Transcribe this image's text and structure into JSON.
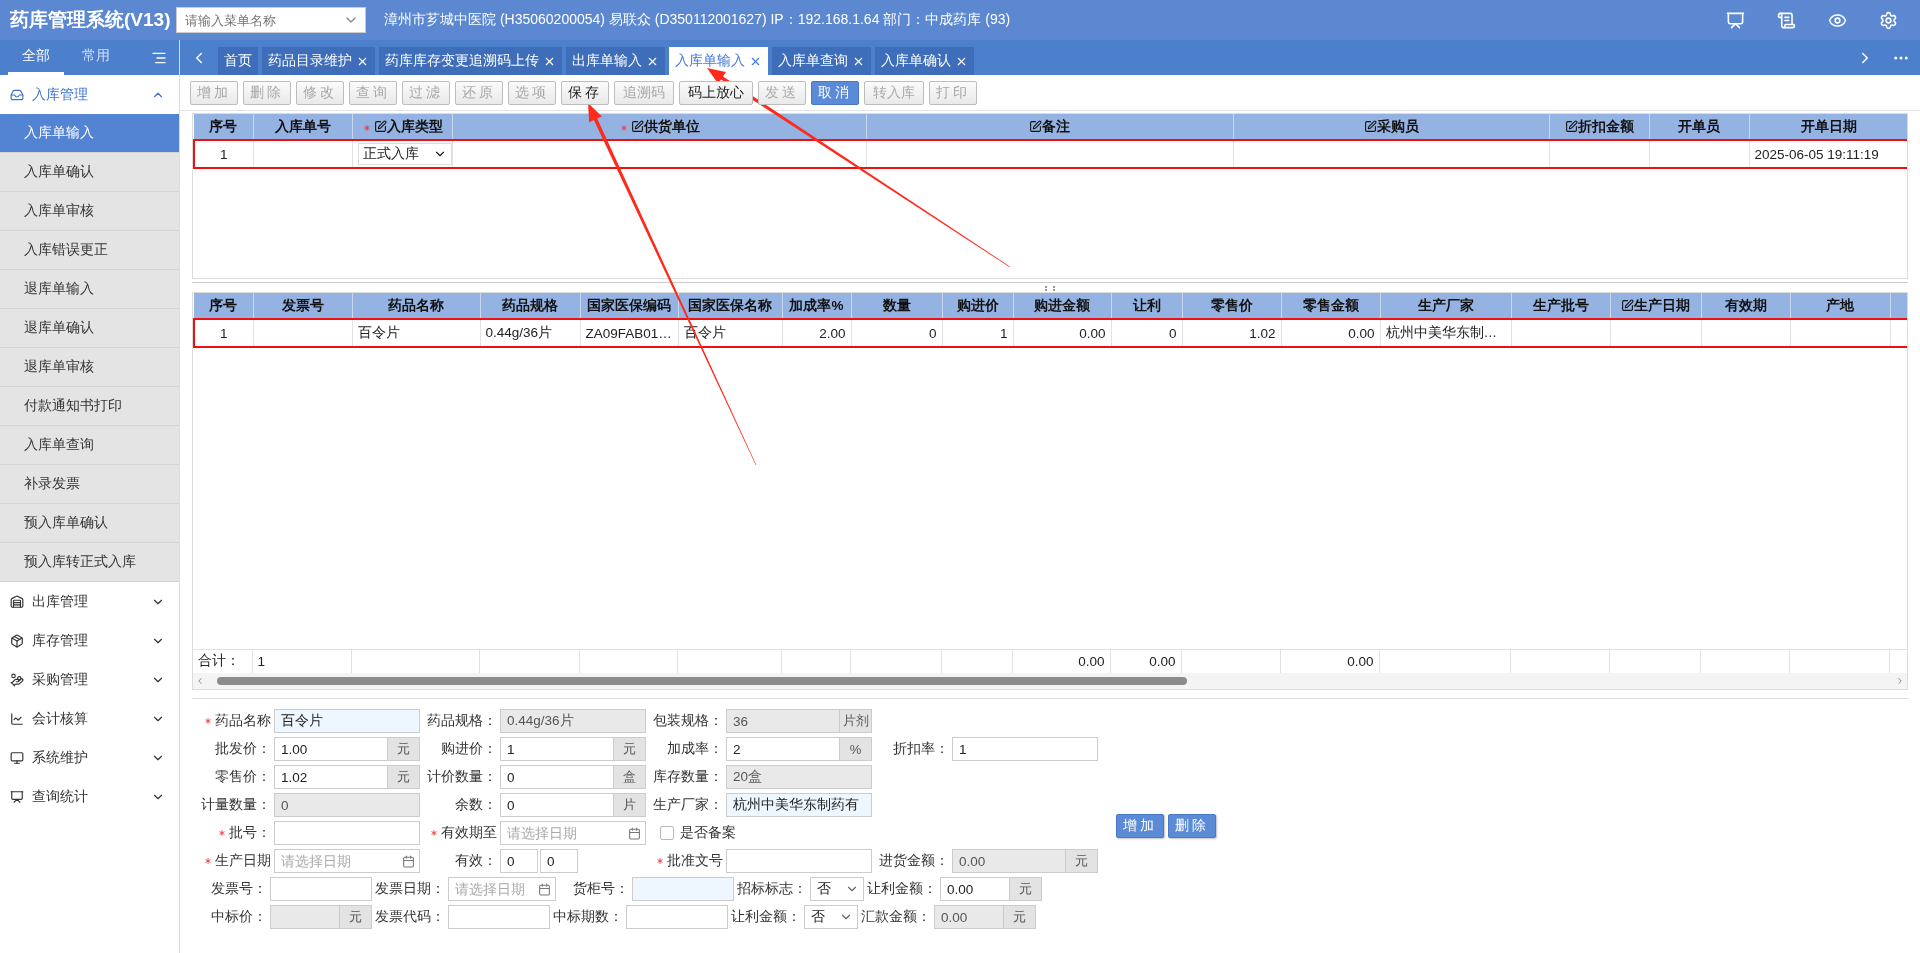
{
  "header": {
    "title": "药库管理系统(V13)",
    "menu_search": {
      "placeholder": "请输入菜单名称"
    },
    "info": "漳州市芗城中医院 (H35060200054) 易联众 (D350112001627) IP：192.168.1.64 部门：中成药库 (93)"
  },
  "sidebar": {
    "tabs": [
      {
        "label": "全部",
        "selected": true
      },
      {
        "label": "常用",
        "selected": false
      }
    ],
    "groups": [
      {
        "label": "入库管理",
        "expanded": true,
        "children": [
          {
            "label": "入库单输入",
            "selected": true
          },
          {
            "label": "入库单确认",
            "selected": false
          },
          {
            "label": "入库单审核",
            "selected": false
          },
          {
            "label": "入库错误更正",
            "selected": false
          },
          {
            "label": "退库单输入",
            "selected": false
          },
          {
            "label": "退库单确认",
            "selected": false
          },
          {
            "label": "退库单审核",
            "selected": false
          },
          {
            "label": "付款通知书打印",
            "selected": false
          },
          {
            "label": "入库单查询",
            "selected": false
          },
          {
            "label": "补录发票",
            "selected": false
          },
          {
            "label": "预入库单确认",
            "selected": false
          },
          {
            "label": "预入库转正式入库",
            "selected": false
          }
        ]
      },
      {
        "label": "出库管理",
        "expanded": false
      },
      {
        "label": "库存管理",
        "expanded": false
      },
      {
        "label": "采购管理",
        "expanded": false
      },
      {
        "label": "会计核算",
        "expanded": false
      },
      {
        "label": "系统维护",
        "expanded": false
      },
      {
        "label": "查询统计",
        "expanded": false
      }
    ]
  },
  "tabs": [
    {
      "label": "首页",
      "closable": false,
      "selected": false
    },
    {
      "label": "药品目录维护",
      "closable": true,
      "selected": false
    },
    {
      "label": "药库库存变更追溯码上传",
      "closable": true,
      "selected": false
    },
    {
      "label": "出库单输入",
      "closable": true,
      "selected": false
    },
    {
      "label": "入库单输入",
      "closable": true,
      "selected": true
    },
    {
      "label": "入库单查询",
      "closable": true,
      "selected": false
    },
    {
      "label": "入库单确认",
      "closable": true,
      "selected": false
    }
  ],
  "toolbar": [
    {
      "label": "增加",
      "disabled": true,
      "primary": false
    },
    {
      "label": "删除",
      "disabled": true,
      "primary": false
    },
    {
      "label": "修改",
      "disabled": true,
      "primary": false
    },
    {
      "label": "查询",
      "disabled": true,
      "primary": false
    },
    {
      "label": "过滤",
      "disabled": true,
      "primary": false
    },
    {
      "label": "还原",
      "disabled": true,
      "primary": false
    },
    {
      "label": "选项",
      "disabled": true,
      "primary": false
    },
    {
      "label": "保存",
      "disabled": false,
      "primary": false
    },
    {
      "label": "追溯码",
      "disabled": true,
      "primary": false
    },
    {
      "label": "码上放心",
      "disabled": false,
      "primary": false
    },
    {
      "label": "发送",
      "disabled": true,
      "primary": false
    },
    {
      "label": "取消",
      "disabled": false,
      "primary": true
    },
    {
      "label": "转入库",
      "disabled": true,
      "primary": false
    },
    {
      "label": "打印",
      "disabled": true,
      "primary": false
    }
  ],
  "upper_table": {
    "columns": [
      {
        "label": "序号"
      },
      {
        "label": "入库单号"
      },
      {
        "label": "入库类型",
        "required": true,
        "editable": true,
        "kind": "select"
      },
      {
        "label": "供货单位",
        "required": true,
        "editable": true
      },
      {
        "label": "备注",
        "editable": true
      },
      {
        "label": "采购员",
        "editable": true
      },
      {
        "label": "折扣金额",
        "editable": true
      },
      {
        "label": "开单员"
      },
      {
        "label": "开单日期"
      }
    ],
    "rows": [
      {
        "outlined": true,
        "cells": [
          "1",
          null,
          "正式入库",
          null,
          null,
          null,
          null,
          null,
          "2025-06-05 19:11:19"
        ]
      }
    ]
  },
  "lower_table": {
    "columns": [
      {
        "label": "序号"
      },
      {
        "label": "发票号",
        "total": "1"
      },
      {
        "label": "药品名称"
      },
      {
        "label": "药品规格"
      },
      {
        "label": "国家医保编码"
      },
      {
        "label": "国家医保名称"
      },
      {
        "label": "加成率%"
      },
      {
        "label": "数量"
      },
      {
        "label": "购进价"
      },
      {
        "label": "购进金额",
        "total": "0.00"
      },
      {
        "label": "让利",
        "total": "0.00"
      },
      {
        "label": "零售价"
      },
      {
        "label": "零售金额",
        "total": "0.00"
      },
      {
        "label": "生产厂家"
      },
      {
        "label": "生产批号"
      },
      {
        "label": "生产日期",
        "editable": true
      },
      {
        "label": "有效期"
      },
      {
        "label": "产地"
      }
    ],
    "rows": [
      {
        "outlined": true,
        "cells": [
          "1",
          null,
          "百令片",
          "0.44g/36片",
          "ZA09FAB01…",
          "百令片",
          "2.00",
          "0",
          "1",
          "0.00",
          "0",
          "1.02",
          "0.00",
          "杭州中美华东制…",
          null,
          null,
          null,
          null
        ]
      }
    ],
    "totals_label": "合计："
  },
  "form": {
    "rows": [
      [
        {
          "kind": "text",
          "label": "药品名称",
          "required": true,
          "value": "百令片",
          "highlighted": true
        },
        {
          "kind": "text",
          "label": "药品规格：",
          "value": "0.44g/36片",
          "readonly": true
        },
        {
          "kind": "text",
          "label": "包装规格：",
          "value": "36",
          "readonly": true,
          "unit": "片剂"
        }
      ],
      [
        {
          "kind": "text",
          "label": "批发价：",
          "value": "1.00",
          "unit": "元"
        },
        {
          "kind": "text",
          "label": "购进价：",
          "value": "1",
          "unit": "元"
        },
        {
          "kind": "text",
          "label": "加成率：",
          "value": "2",
          "unit": "%"
        },
        {
          "kind": "text",
          "label": "折扣率：",
          "value": "1"
        }
      ],
      [
        {
          "kind": "text",
          "label": "零售价：",
          "value": "1.02",
          "unit": "元"
        },
        {
          "kind": "text",
          "label": "计价数量：",
          "value": "0",
          "unit": "盒"
        },
        {
          "kind": "text",
          "label": "库存数量：",
          "value": "20盒",
          "readonly": true
        }
      ],
      [
        {
          "kind": "text",
          "label": "计量数量：",
          "value": "0",
          "readonly": true
        },
        {
          "kind": "text",
          "label": "余数：",
          "value": "0",
          "unit": "片"
        },
        {
          "kind": "text",
          "label": "生产厂家：",
          "value": "杭州中美华东制药有",
          "highlighted": true
        }
      ],
      [
        {
          "kind": "text",
          "label": "批号：",
          "required": true
        },
        {
          "kind": "date",
          "label": "有效期至",
          "required": true,
          "placeholder": "请选择日期"
        },
        {
          "kind": "checkbox",
          "label": "是否备案",
          "checked": false
        }
      ],
      [
        {
          "kind": "date",
          "label": "生产日期",
          "required": true,
          "placeholder": "请选择日期"
        },
        {
          "kind": "pair",
          "label": "有效：",
          "values": [
            "0",
            "0"
          ]
        },
        {
          "kind": "text",
          "label": "批准文号",
          "required": true
        },
        {
          "kind": "text",
          "label": "进货金额：",
          "value": "0.00",
          "readonly": true,
          "unit": "元"
        }
      ],
      [
        {
          "kind": "text",
          "label": "发票号："
        },
        {
          "kind": "date",
          "label": "发票日期：",
          "placeholder": "请选择日期"
        },
        {
          "kind": "text",
          "label": "货柜号：",
          "highlighted": true
        },
        {
          "kind": "select",
          "label": "招标标志：",
          "value": "否"
        },
        {
          "kind": "text",
          "label": "让利金额：",
          "value": "0.00",
          "unit": "元"
        }
      ],
      [
        {
          "kind": "text",
          "label": "中标价：",
          "readonly": true,
          "unit": "元"
        },
        {
          "kind": "text",
          "label": "发票代码："
        },
        {
          "kind": "text",
          "label": "中标期数："
        },
        {
          "kind": "select",
          "label": "让利金额：",
          "value": "否"
        },
        {
          "kind": "text",
          "label": "汇款金额：",
          "value": "0.00",
          "readonly": true,
          "unit": "元"
        }
      ]
    ],
    "buttons": [
      "增加",
      "删除"
    ]
  }
}
